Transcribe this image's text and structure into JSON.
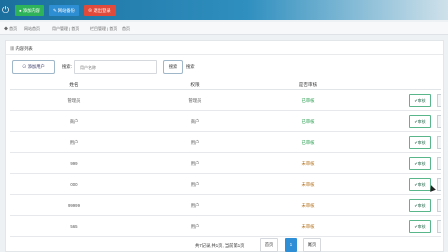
{
  "topbar": {
    "power_icon": "power-icon",
    "buttons": [
      {
        "label": "● 添加内容",
        "color": "#2fb35a"
      },
      {
        "label": "✎ 网站备份",
        "color": "#2e8ed3"
      },
      {
        "label": "⊗ 退出登录",
        "color": "#e04a3a"
      }
    ]
  },
  "breadcrumb": {
    "items": [
      "◆ 首页",
      "网站首页",
      "用户管理 | 首页",
      "栏目管理 | 首页",
      "首页"
    ]
  },
  "panel": {
    "title": "▦ 内容列表",
    "add_button": "⊙ 添加用户",
    "search_label": "搜索:",
    "search_placeholder": "用户名称",
    "search_button": "搜索",
    "search_extra": "搜索"
  },
  "table": {
    "headers": [
      "姓名",
      "权限",
      "是否审核"
    ],
    "rows": [
      {
        "name": "管理员",
        "role": "管理员",
        "status": "已审核",
        "pending": false,
        "action": "✔审核"
      },
      {
        "name": "商户",
        "role": "商户",
        "status": "已审核",
        "pending": false,
        "action": "✔审核"
      },
      {
        "name": "用户",
        "role": "用户",
        "status": "已审核",
        "pending": false,
        "action": "✔审核"
      },
      {
        "name": "999",
        "role": "用户",
        "status": "未审核",
        "pending": true,
        "action": "✔审核"
      },
      {
        "name": "000",
        "role": "用户",
        "status": "未审核",
        "pending": true,
        "action": "✔审核"
      },
      {
        "name": "99999",
        "role": "用户",
        "status": "未审核",
        "pending": true,
        "action": "✔审核"
      },
      {
        "name": "565",
        "role": "用户",
        "status": "未审核",
        "pending": true,
        "action": "✔审核"
      }
    ]
  },
  "pagination": {
    "info": "共7记录,共1页, 当前第1页",
    "first": "首页",
    "current": "1",
    "last": "尾页"
  },
  "colors": {
    "approved": "#1e9a45",
    "pending": "#b06a10",
    "primary": "#2f8fd6"
  }
}
